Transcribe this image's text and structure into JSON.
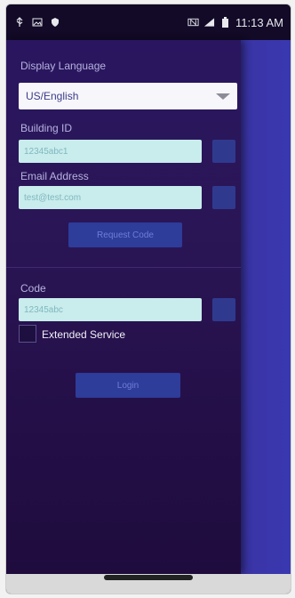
{
  "status_bar": {
    "time": "11:13 AM",
    "left_icons": [
      "usb-icon",
      "image-icon",
      "shield-icon"
    ],
    "right_icons": [
      "nfc-icon",
      "signal-icon",
      "battery-icon"
    ]
  },
  "form": {
    "display_language_label": "Display Language",
    "language_value": "US/English",
    "building_label": "Building ID",
    "building_value": "12345abc1",
    "email_label": "Email Address",
    "email_value": "test@test.com",
    "request_code_label": "Request Code",
    "code_label": "Code",
    "code_value": "12345abc",
    "extended_service_label": "Extended Service",
    "login_label": "Login"
  },
  "colors": {
    "accent": "#2e3c9a",
    "drawer_bg": "#2a1660",
    "input_bg": "#c9ecec"
  }
}
